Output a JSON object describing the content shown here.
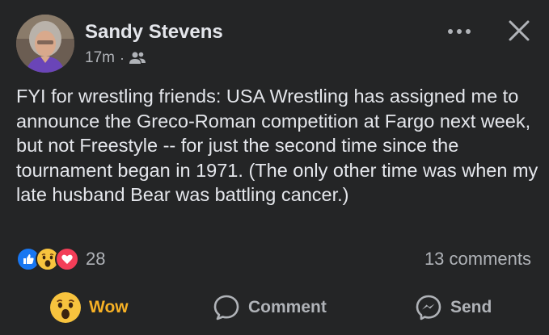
{
  "post": {
    "author": "Sandy Stevens",
    "time": "17m",
    "separator": "·",
    "audience_icon": "friends-icon",
    "text": "FYI for wrestling friends: USA Wrestling has assigned me to announce the Greco-Roman competition at Fargo next week, but not Freestyle -- for just the second time since the tournament began in 1971. (The only other time was when my late husband Bear was battling cancer.)"
  },
  "reactions": {
    "icons": [
      "like-icon",
      "wow-icon",
      "love-icon"
    ],
    "count": "28",
    "comments": "13 comments"
  },
  "actions": {
    "wow_label": "Wow",
    "comment_label": "Comment",
    "send_label": "Send"
  },
  "colors": {
    "background": "#242526",
    "primary_text": "#e4e6eb",
    "secondary_text": "#b0b3b8",
    "wow_accent": "#f7b125",
    "like_blue": "#1877f2",
    "love_red": "#f33e58"
  }
}
